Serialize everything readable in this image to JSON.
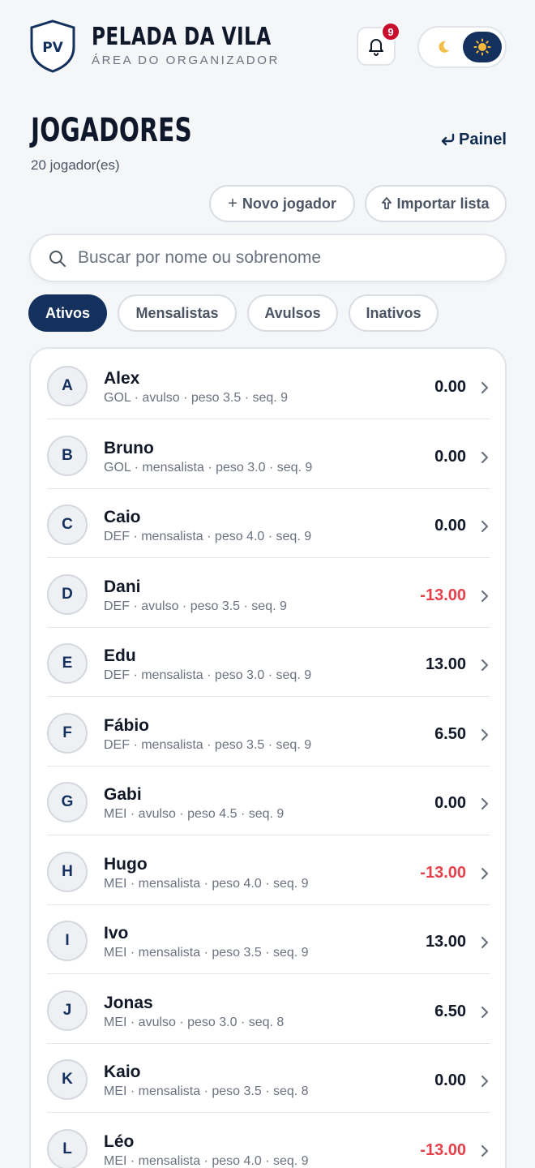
{
  "app": {
    "logo_text": "PV",
    "title": "PELADA DA VILA",
    "subtitle": "ÁREA DO ORGANIZADOR",
    "notification_count": "9"
  },
  "page": {
    "title": "JOGADORES",
    "count": "20 jogador(es)",
    "panel_link": "Painel",
    "new_player_button": "Novo jogador",
    "import_button": "Importar lista"
  },
  "search": {
    "placeholder": "Buscar por nome ou sobrenome",
    "value": ""
  },
  "filters": [
    {
      "label": "Ativos",
      "active": true
    },
    {
      "label": "Mensalistas",
      "active": false
    },
    {
      "label": "Avulsos",
      "active": false
    },
    {
      "label": "Inativos",
      "active": false
    }
  ],
  "players": [
    {
      "initial": "A",
      "name": "Alex",
      "meta": "GOL · avulso · peso 3.5 · seq. 9",
      "balance": "0.00",
      "negative": false
    },
    {
      "initial": "B",
      "name": "Bruno",
      "meta": "GOL · mensalista · peso 3.0 · seq. 9",
      "balance": "0.00",
      "negative": false
    },
    {
      "initial": "C",
      "name": "Caio",
      "meta": "DEF · mensalista · peso 4.0 · seq. 9",
      "balance": "0.00",
      "negative": false
    },
    {
      "initial": "D",
      "name": "Dani",
      "meta": "DEF · avulso · peso 3.5 · seq. 9",
      "balance": "-13.00",
      "negative": true
    },
    {
      "initial": "E",
      "name": "Edu",
      "meta": "DEF · mensalista · peso 3.0 · seq. 9",
      "balance": "13.00",
      "negative": false
    },
    {
      "initial": "F",
      "name": "Fábio",
      "meta": "DEF · mensalista · peso 3.5 · seq. 9",
      "balance": "6.50",
      "negative": false
    },
    {
      "initial": "G",
      "name": "Gabi",
      "meta": "MEI · avulso · peso 4.5 · seq. 9",
      "balance": "0.00",
      "negative": false
    },
    {
      "initial": "H",
      "name": "Hugo",
      "meta": "MEI · mensalista · peso 4.0 · seq. 9",
      "balance": "-13.00",
      "negative": true
    },
    {
      "initial": "I",
      "name": "Ivo",
      "meta": "MEI · mensalista · peso 3.5 · seq. 9",
      "balance": "13.00",
      "negative": false
    },
    {
      "initial": "J",
      "name": "Jonas",
      "meta": "MEI · avulso · peso 3.0 · seq. 8",
      "balance": "6.50",
      "negative": false
    },
    {
      "initial": "K",
      "name": "Kaio",
      "meta": "MEI · mensalista · peso 3.5 · seq. 8",
      "balance": "0.00",
      "negative": false
    },
    {
      "initial": "L",
      "name": "Léo",
      "meta": "MEI · mensalista · peso 4.0 · seq. 9",
      "balance": "-13.00",
      "negative": true
    }
  ],
  "colors": {
    "primary": "#13315c",
    "negative": "#e5414b",
    "badge": "#c8102e"
  }
}
